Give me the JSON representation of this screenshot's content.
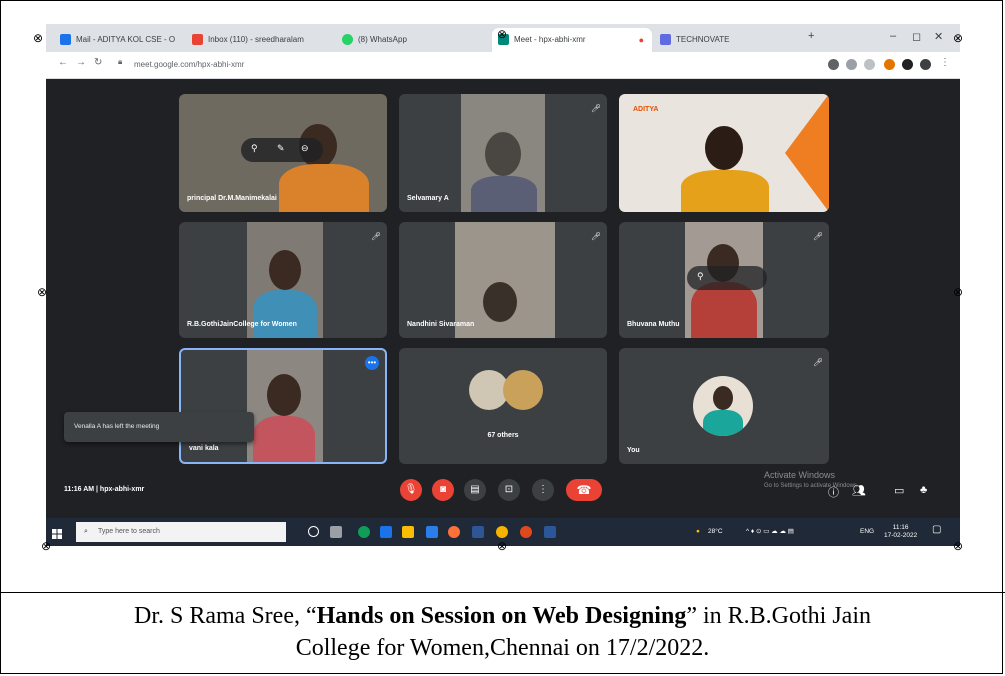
{
  "browser": {
    "tabs": [
      {
        "label": "Mail - ADITYA KOL CSE - O",
        "color": "#1a73e8"
      },
      {
        "label": "Inbox (110) - sreedharalam",
        "color": "#ea4335"
      },
      {
        "label": "(8) WhatsApp",
        "color": "#25d366"
      },
      {
        "label": "Meet - hpx-abhi-xmr",
        "color": "#00897b"
      },
      {
        "label": "TECHNOVATE",
        "color": "#5f6be0"
      }
    ],
    "url": "meet.google.com/hpx-abhi-xmr",
    "window_controls": [
      "–",
      "◻",
      "✕"
    ],
    "new_tab": "+"
  },
  "participants": [
    {
      "name": "principal Dr.M.Manimekalai",
      "bg": "#6f6a5f"
    },
    {
      "name": "Selvamary A",
      "bg": "#5a5c60"
    },
    {
      "name": "",
      "bg": "#e9e4dd"
    },
    {
      "name": "R.B.GothiJainCollege for Women",
      "bg": "#4b4e53"
    },
    {
      "name": "Nandhini Sivaraman",
      "bg": "#5c5a58"
    },
    {
      "name": "Bhuvana Muthu",
      "bg": "#6a5f5d"
    },
    {
      "name": "vani kala",
      "bg": "#6f6d6a"
    },
    {
      "name": "67 others",
      "bg": "#3c4043"
    },
    {
      "name": "You",
      "bg": "#3c4043"
    }
  ],
  "brand_label": "ADITYA",
  "toast": "Venalla A has left the meeting",
  "meeting_info": "11:16 AM  |  hpx-abhi-xmr",
  "activate": {
    "line1": "Activate Windows",
    "line2": "Go to Settings to activate Windows."
  },
  "taskbar": {
    "search_placeholder": "Type here to search",
    "weather": "28°C",
    "lang": "ENG",
    "time": "11:16",
    "date": "17-02-2022"
  },
  "caption": {
    "part1": "Dr. S Rama Sree, “",
    "bold": "Hands on Session on Web Designing",
    "part2": "” in R.B.Gothi Jain",
    "line2": "College for Women,Chennai on 17/2/2022."
  },
  "colors": {
    "meet_bg": "#202124",
    "tile_bg": "#3c4043",
    "end_call": "#ea4335",
    "active_border": "#8ab4f8"
  }
}
